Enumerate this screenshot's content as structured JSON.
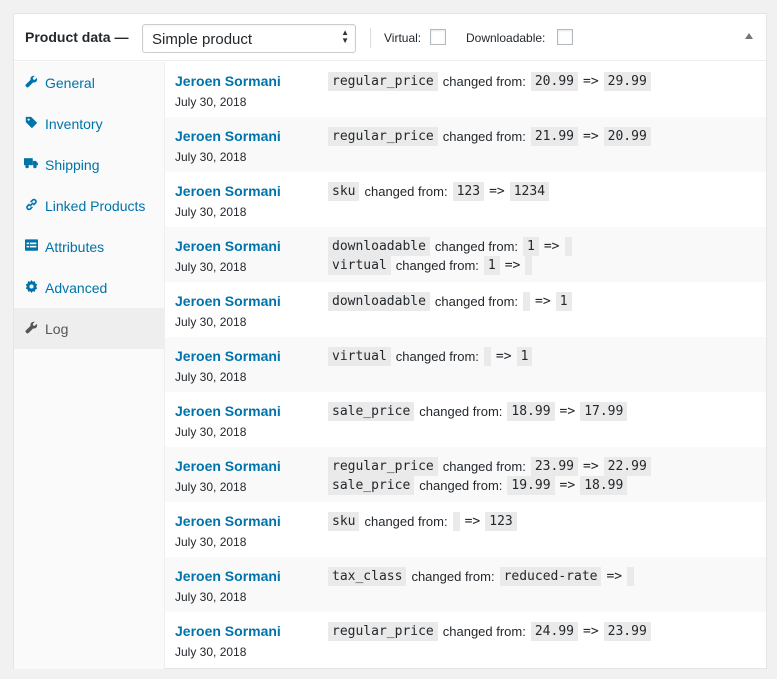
{
  "header": {
    "title": "Product data —",
    "product_type": "Simple product",
    "virtual_label": "Virtual:",
    "downloadable_label": "Downloadable:"
  },
  "tabs": [
    {
      "label": "General",
      "icon": "wrench-icon"
    },
    {
      "label": "Inventory",
      "icon": "tag-icon"
    },
    {
      "label": "Shipping",
      "icon": "truck-icon"
    },
    {
      "label": "Linked Products",
      "icon": "link-icon"
    },
    {
      "label": "Attributes",
      "icon": "table-icon"
    },
    {
      "label": "Advanced",
      "icon": "gear-icon"
    },
    {
      "label": "Log",
      "icon": "wrench-icon",
      "active": true
    }
  ],
  "log": {
    "changed_from": "changed from:",
    "arrow": "=>",
    "entries": [
      {
        "author": "Jeroen Sormani",
        "date": "July 30, 2018",
        "changes": [
          {
            "field": "regular_price",
            "from": "20.99",
            "to": "29.99"
          }
        ]
      },
      {
        "author": "Jeroen Sormani",
        "date": "July 30, 2018",
        "changes": [
          {
            "field": "regular_price",
            "from": "21.99",
            "to": "20.99"
          }
        ]
      },
      {
        "author": "Jeroen Sormani",
        "date": "July 30, 2018",
        "changes": [
          {
            "field": "sku",
            "from": "123",
            "to": "1234"
          }
        ]
      },
      {
        "author": "Jeroen Sormani",
        "date": "July 30, 2018",
        "changes": [
          {
            "field": "downloadable",
            "from": "1",
            "to": ""
          },
          {
            "field": "virtual",
            "from": "1",
            "to": ""
          }
        ]
      },
      {
        "author": "Jeroen Sormani",
        "date": "July 30, 2018",
        "changes": [
          {
            "field": "downloadable",
            "from": "",
            "to": "1"
          }
        ]
      },
      {
        "author": "Jeroen Sormani",
        "date": "July 30, 2018",
        "changes": [
          {
            "field": "virtual",
            "from": "",
            "to": "1"
          }
        ]
      },
      {
        "author": "Jeroen Sormani",
        "date": "July 30, 2018",
        "changes": [
          {
            "field": "sale_price",
            "from": "18.99",
            "to": "17.99"
          }
        ]
      },
      {
        "author": "Jeroen Sormani",
        "date": "July 30, 2018",
        "changes": [
          {
            "field": "regular_price",
            "from": "23.99",
            "to": "22.99"
          },
          {
            "field": "sale_price",
            "from": "19.99",
            "to": "18.99"
          }
        ]
      },
      {
        "author": "Jeroen Sormani",
        "date": "July 30, 2018",
        "changes": [
          {
            "field": "sku",
            "from": "",
            "to": "123"
          }
        ]
      },
      {
        "author": "Jeroen Sormani",
        "date": "July 30, 2018",
        "changes": [
          {
            "field": "tax_class",
            "from": "reduced-rate",
            "to": ""
          }
        ]
      },
      {
        "author": "Jeroen Sormani",
        "date": "July 30, 2018",
        "changes": [
          {
            "field": "regular_price",
            "from": "24.99",
            "to": "23.99"
          }
        ]
      }
    ]
  }
}
